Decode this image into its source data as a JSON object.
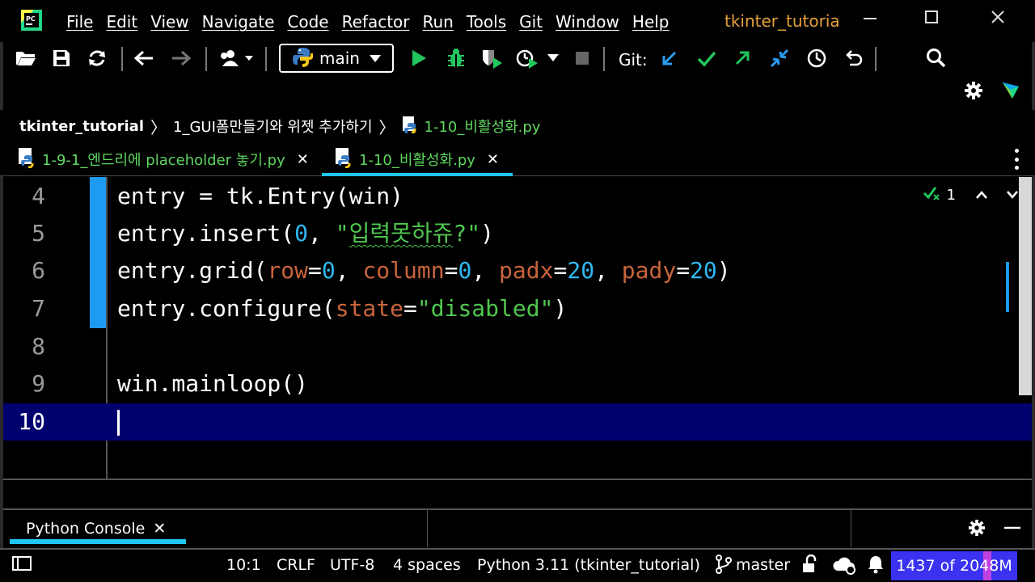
{
  "menu": [
    "File",
    "Edit",
    "View",
    "Navigate",
    "Code",
    "Refactor",
    "Run",
    "Tools",
    "Git",
    "Window",
    "Help"
  ],
  "project_title": "tkinter_tutoria",
  "toolbar": {
    "branch_label": "main",
    "git_label": "Git:"
  },
  "breadcrumb": {
    "project": "tkinter_tutorial",
    "folder": "1_GUI폼만들기와 위젯 추가하기",
    "file": "1-10_비활성화.py"
  },
  "tabs": [
    {
      "label": "1-9-1_엔드리에 placeholder 놓기.py",
      "active": false
    },
    {
      "label": "1-10_비활성화.py",
      "active": true
    }
  ],
  "editor": {
    "inspection_count": "1",
    "lines": [
      {
        "num": "4",
        "text": "entry = tk.Entry(win)"
      },
      {
        "num": "5",
        "text": "entry.insert(0, \"입력못하쥬?\")"
      },
      {
        "num": "6",
        "text": "entry.grid(row=0, column=0, padx=20, pady=20)"
      },
      {
        "num": "7",
        "text": "entry.configure(state=\"disabled\")"
      },
      {
        "num": "8",
        "text": ""
      },
      {
        "num": "9",
        "text": "win.mainloop()"
      },
      {
        "num": "10",
        "text": ""
      }
    ]
  },
  "console": {
    "tab_label": "Python Console"
  },
  "status": {
    "position": "10:1",
    "line_ending": "CRLF",
    "encoding": "UTF-8",
    "indent": "4 spaces",
    "interpreter": "Python 3.11 (tkinter_tutorial)",
    "branch": "master",
    "memory": "1437 of 2048M"
  },
  "colors": {
    "accent": "#1ec6f0",
    "string": "#4fc74f",
    "number": "#2fb8f0",
    "param": "#c8643c",
    "project_title": "#e6a03c",
    "current_line": "#00006e"
  }
}
